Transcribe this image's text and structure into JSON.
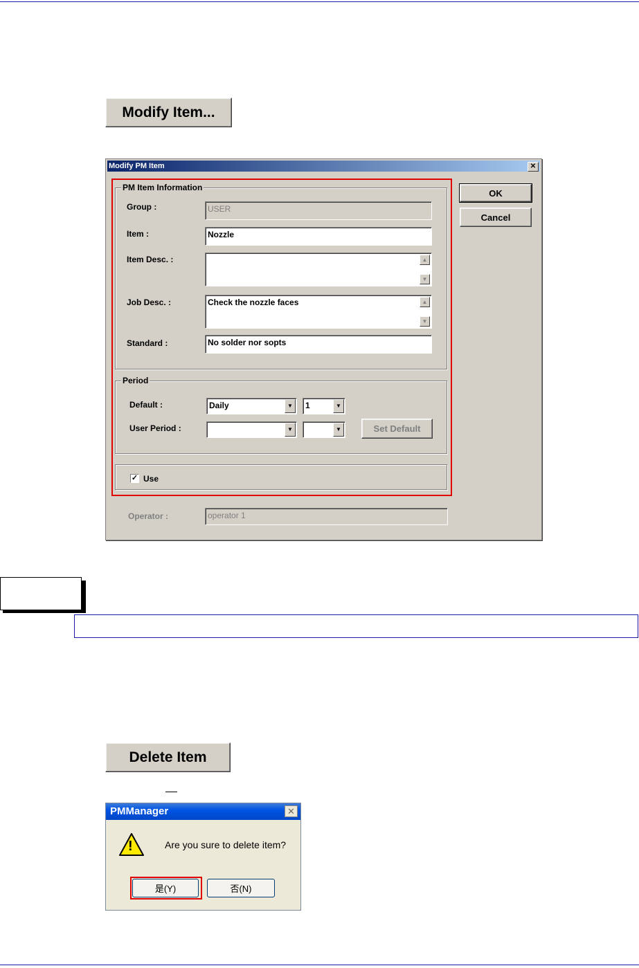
{
  "modify_button": {
    "label": "Modify Item..."
  },
  "modify_dialog": {
    "title": "Modify PM Item",
    "close_glyph": "✕",
    "pm_info_group": "PM Item Information",
    "group_label": "Group :",
    "group_value": "USER",
    "item_label": "Item :",
    "item_value": "Nozzle",
    "item_desc_label": "Item Desc. :",
    "item_desc_value": "",
    "job_desc_label": "Job Desc. :",
    "job_desc_value": "Check the nozzle faces",
    "standard_label": "Standard :",
    "standard_value": "No solder nor sopts",
    "period_group": "Period",
    "default_label": "Default :",
    "default_period": "Daily",
    "default_count": "1",
    "user_period_label": "User Period :",
    "user_period_value": "",
    "user_count_value": "",
    "set_default_button": "Set Default",
    "use_checkbox_label": "Use",
    "use_checked": "✓",
    "operator_label": "Operator :",
    "operator_value": "operator 1",
    "ok_button": "OK",
    "cancel_button": "Cancel"
  },
  "delete_button": {
    "label": "Delete Item"
  },
  "confirm_dialog": {
    "title": "PMManager",
    "close_glyph": "✕",
    "message": "Are you sure to delete item?",
    "warning_glyph": "!",
    "yes_button": "是(Y)",
    "no_button": "否(N)"
  },
  "colors": {
    "highlight": "#e00000",
    "rule": "#1a1aa8"
  }
}
